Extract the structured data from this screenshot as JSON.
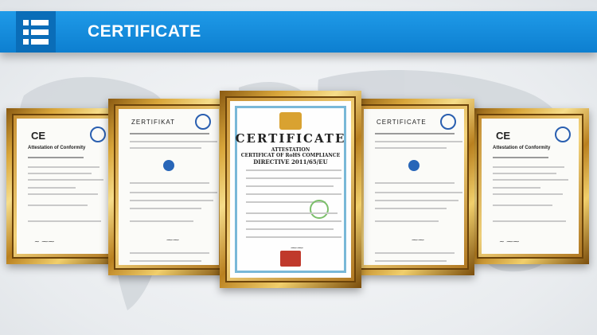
{
  "header": {
    "title": "CERTIFICATE",
    "color": "#1589dc"
  },
  "certificates": {
    "left_outer": {
      "title": "Attestation of Conformity",
      "mark": "CE"
    },
    "left_inner": {
      "title": "ZERTIFIKAT"
    },
    "center": {
      "title": "CERTIFICATE",
      "subtitle": "ATTESTATION",
      "line2": "CERTIFICAT OF RoHS COMPLIANCE",
      "line3": "DIRECTIVE 2011/65/EU"
    },
    "right_inner": {
      "title": "CERTIFICATE"
    },
    "right_outer": {
      "title": "Attestation of Conformity",
      "mark": "CE"
    }
  },
  "icons": {
    "menu": "list-menu-icon"
  }
}
